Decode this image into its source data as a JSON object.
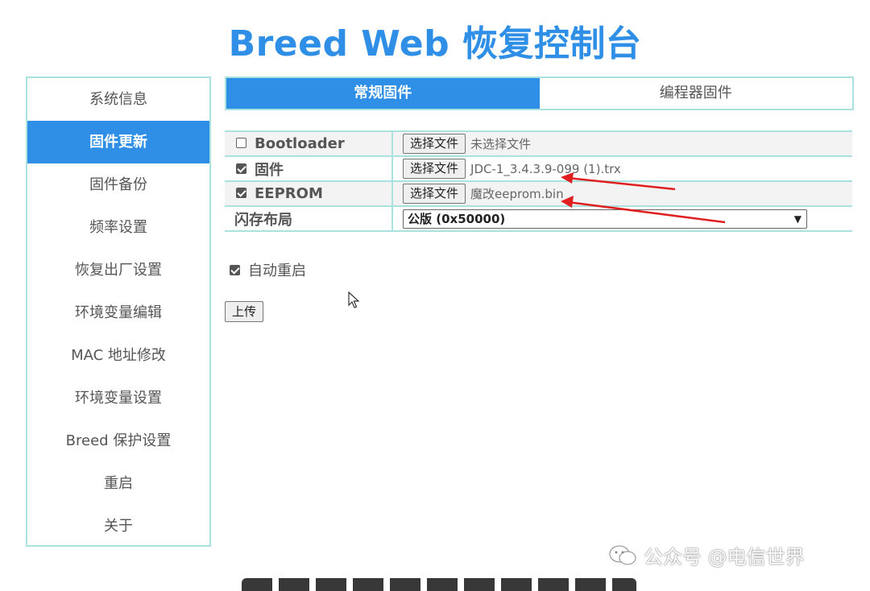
{
  "app": {
    "title": "Breed Web 恢复控制台"
  },
  "sidebar": {
    "items": [
      {
        "label": "系统信息"
      },
      {
        "label": "固件更新"
      },
      {
        "label": "固件备份"
      },
      {
        "label": "频率设置"
      },
      {
        "label": "恢复出厂设置"
      },
      {
        "label": "环境变量编辑"
      },
      {
        "label": "MAC 地址修改"
      },
      {
        "label": "环境变量设置"
      },
      {
        "label": "Breed 保护设置"
      },
      {
        "label": "重启"
      },
      {
        "label": "关于"
      }
    ],
    "active_index": 1
  },
  "tabs": [
    {
      "label": "常规固件",
      "active": true
    },
    {
      "label": "编程器固件",
      "active": false
    }
  ],
  "form": {
    "rows": [
      {
        "label": "Bootloader",
        "checked": false,
        "button": "选择文件",
        "file": "未选择文件"
      },
      {
        "label": "固件",
        "checked": true,
        "button": "选择文件",
        "file": "JDC-1_3.4.3.9-099 (1).trx"
      },
      {
        "label": "EEPROM",
        "checked": true,
        "button": "选择文件",
        "file": "魔改eeprom.bin"
      }
    ],
    "layout": {
      "label": "闪存布局",
      "selected": "公版 (0x50000)"
    },
    "auto_restart": {
      "label": "自动重启",
      "checked": true
    },
    "upload_label": "上传"
  },
  "watermark": {
    "text": "公众号 @电信世界"
  },
  "colors": {
    "accent": "#2f8fe6",
    "border": "#a9e2df",
    "arrow": "#e02020"
  }
}
